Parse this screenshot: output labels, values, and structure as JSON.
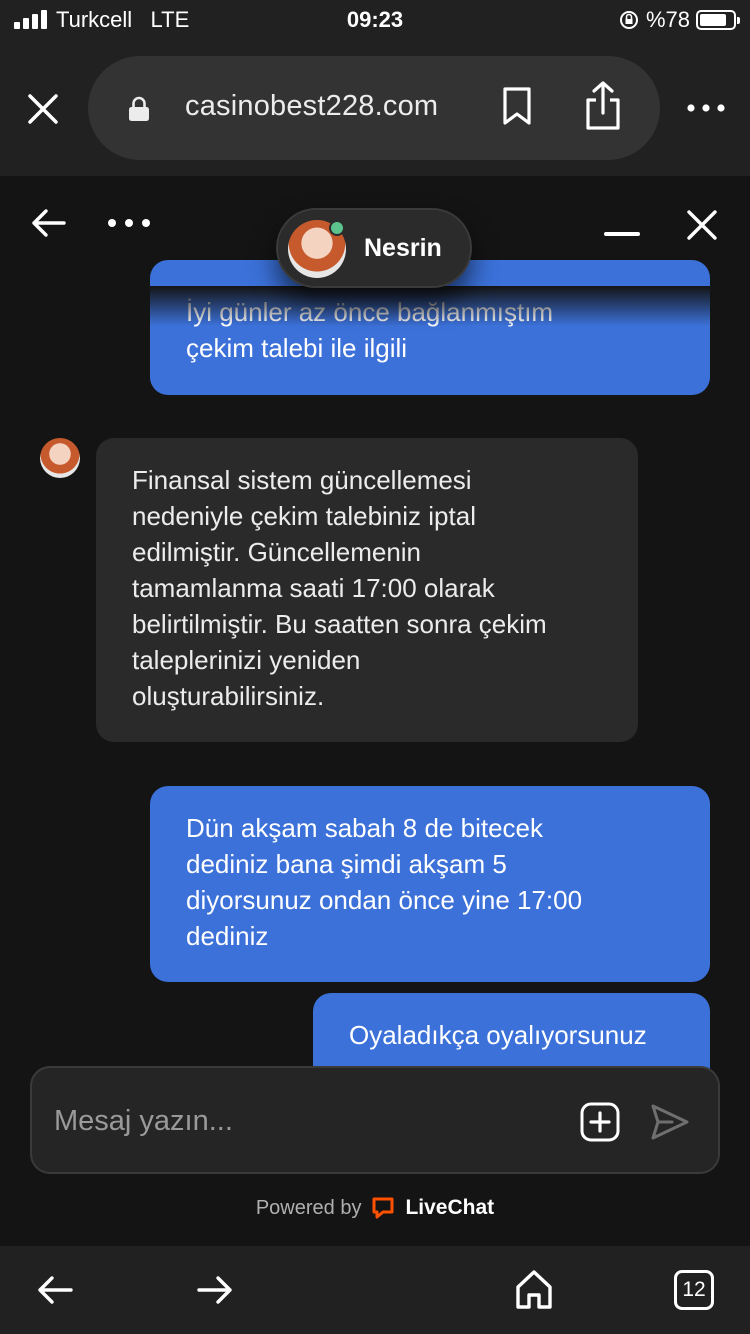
{
  "status_bar": {
    "carrier": "Turkcell",
    "network": "LTE",
    "time": "09:23",
    "battery": "%78"
  },
  "browser": {
    "url": "casinobest228.com"
  },
  "chat": {
    "agent_name": "Nesrin",
    "messages": [
      {
        "sender": "user",
        "text": "İyi günler az önce bağlanmıştım\nçekim talebi ile ilgili"
      },
      {
        "sender": "agent",
        "text": "Finansal sistem güncellemesi\nnedeniyle çekim talebiniz iptal\nedilmiştir. Güncellemenin\ntamamlanma saati 17:00 olarak\nbelirtilmiştir. Bu saatten sonra çekim\ntaleplerinizi yeniden\noluşturabilirsiniz."
      },
      {
        "sender": "user",
        "text": "Dün akşam sabah 8 de bitecek\ndediniz bana şimdi akşam 5\ndiyorsunuz ondan önce yine 17:00\ndediniz"
      },
      {
        "sender": "user",
        "text": "Oyaladıkça oyalıyorsunuz"
      }
    ],
    "composer": {
      "placeholder": "Mesaj yazın...",
      "value": ""
    },
    "powered_by": "Powered by",
    "brand": "LiveChat"
  },
  "toolbar": {
    "tab_count": "12"
  },
  "colors": {
    "user_bubble": "#3b71d9",
    "agent_bubble": "#2a2a2a",
    "online": "#5cc38d",
    "livechat": "#ff5100"
  },
  "icons": [
    "close-icon",
    "lock-icon",
    "bookmark-icon",
    "share-icon",
    "more-icon",
    "back-arrow-icon",
    "minimize-icon",
    "plus-icon",
    "send-icon",
    "home-icon",
    "forward-arrow-icon"
  ]
}
